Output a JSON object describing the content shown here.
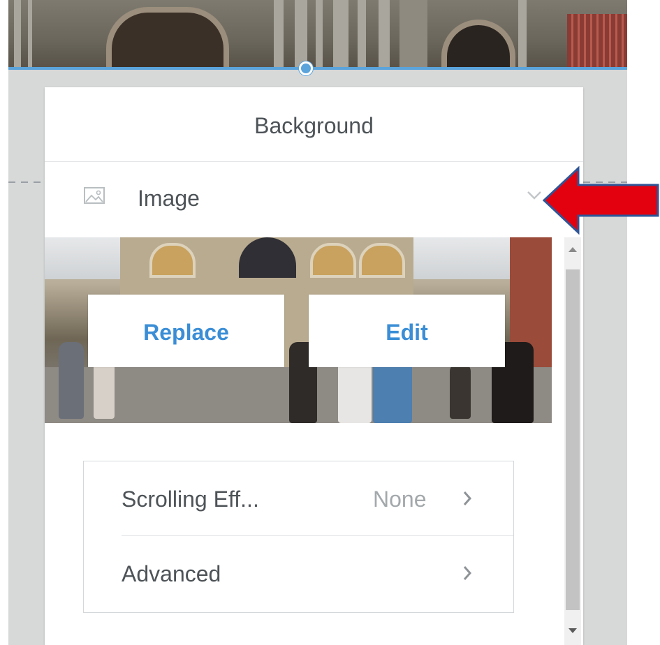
{
  "panel": {
    "title": "Background",
    "type_label": "Image",
    "buttons": {
      "replace": "Replace",
      "edit": "Edit"
    },
    "settings": [
      {
        "label": "Scrolling Eff...",
        "value": "None"
      },
      {
        "label": "Advanced",
        "value": ""
      }
    ]
  },
  "icons": [
    "image-icon",
    "chevron-down-icon",
    "chevron-right-icon",
    "scroll-up-icon",
    "scroll-down-icon"
  ],
  "colors": {
    "accent": "#5aa3db",
    "button_text": "#3a8ed6",
    "annotation_arrow": "#e3000f",
    "annotation_arrow_border": "#2f5597"
  }
}
